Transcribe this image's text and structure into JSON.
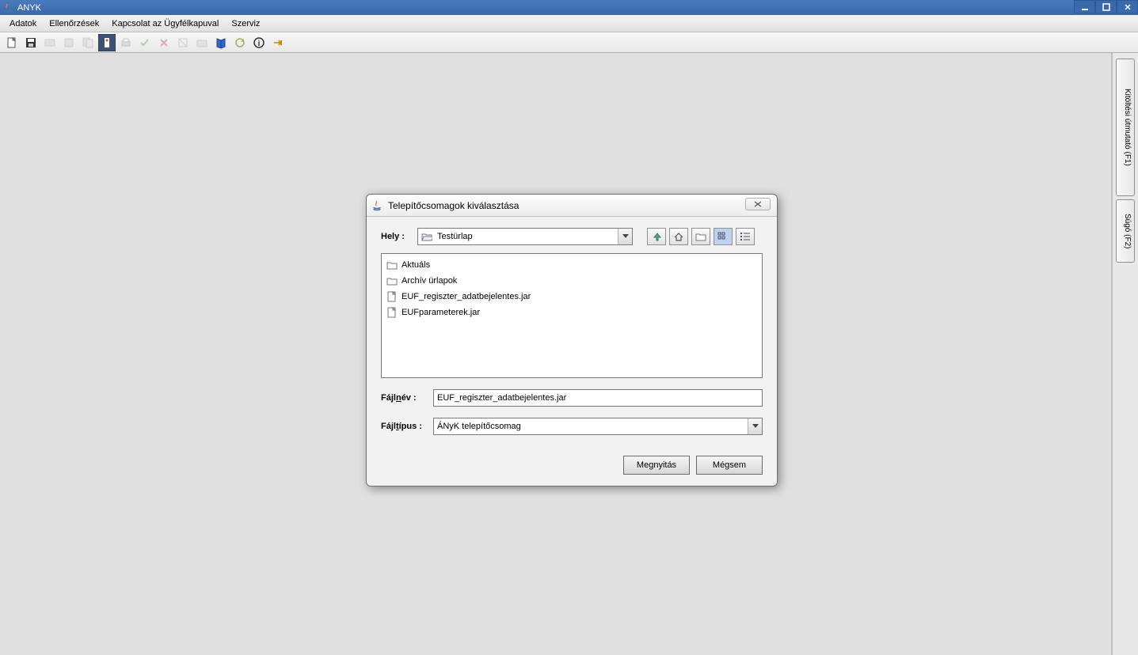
{
  "window": {
    "title": "ANYK"
  },
  "menubar": {
    "items": [
      "Adatok",
      "Ellenőrzések",
      "Kapcsolat az Ügyfélkapuval",
      "Szerviz"
    ]
  },
  "side_tabs": {
    "guide": "Kitöltési útmutató (F1)",
    "help": "Súgó (F2)"
  },
  "dialog": {
    "title": "Telepítőcsomagok kiválasztása",
    "location_label": "Hely :",
    "location_value": "Testürlap",
    "files": [
      {
        "name": "Aktuáls",
        "type": "folder"
      },
      {
        "name": "Archív ürlapok",
        "type": "folder"
      },
      {
        "name": "EUF_regiszter_adatbejelentes.jar",
        "type": "file"
      },
      {
        "name": "EUFparameterek.jar",
        "type": "file"
      }
    ],
    "filename_label_pre": "Fájl",
    "filename_label_u": "n",
    "filename_label_post": "év :",
    "filename_value": "EUF_regiszter_adatbejelentes.jar",
    "filetype_label_pre": "Fájl",
    "filetype_label_u": "t",
    "filetype_label_post": "ípus :",
    "filetype_value": "ÁNyK telepítőcsomag",
    "open_label": "Megnyitás",
    "cancel_label": "Mégsem"
  }
}
